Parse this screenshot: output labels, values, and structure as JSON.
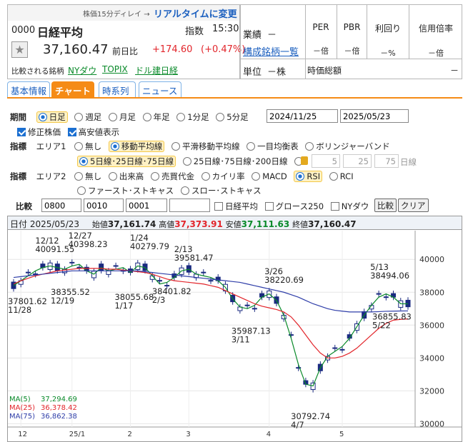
{
  "header": {
    "delay_text": "株価15分ディレイ →",
    "realtime_link": "リアルタイムに変更",
    "code": "0000",
    "name": "日経平均",
    "index_label": "指数",
    "time": "15:30",
    "price": "37,160.47",
    "prev_label": "前日比",
    "change": "+174.60",
    "change_pct": "(+0.47%)",
    "compare_label": "比較される銘柄",
    "compare_links": [
      "NYダウ",
      "TOPIX",
      "ドル建日経"
    ],
    "business_label": "業績",
    "business_value": "－",
    "constituents_link": "構成銘柄一覧",
    "unit_label": "単位",
    "unit_value": "－株",
    "market_cap_label": "時価総額",
    "market_cap_value": "－",
    "metrics": [
      {
        "label": "PER",
        "value": "－倍"
      },
      {
        "label": "PBR",
        "value": "－倍"
      },
      {
        "label": "利回り",
        "value": "－%"
      },
      {
        "label": "信用倍率",
        "value": "－倍"
      }
    ]
  },
  "tabs": [
    "基本情報",
    "チャート",
    "時系列",
    "ニュース"
  ],
  "controls": {
    "period_label": "期間",
    "periods": [
      "日足",
      "週足",
      "月足",
      "年足",
      "1分足",
      "5分足"
    ],
    "date_from": "2024/11/25",
    "date_to": "2025/05/23",
    "opt_adjusted": "修正株価",
    "opt_highlow": "高安値表示",
    "indicator_label": "指標",
    "area1_label": "エリア1",
    "area1_options": [
      "無し",
      "移動平均線",
      "平滑移動平均線",
      "一目均衡表",
      "ボリンジャーバンド"
    ],
    "ma_options": [
      "5日線･25日線･75日線",
      "25日線･75日線･200日線"
    ],
    "ma_inputs": [
      "5",
      "25",
      "75"
    ],
    "ma_unit": "日線",
    "area2_label": "エリア2",
    "area2_options": [
      "無し",
      "出来高",
      "売買代金",
      "カイリ率",
      "MACD",
      "RSI",
      "RCI"
    ],
    "area2_options_row2": [
      "ファースト･ストキャス",
      "スロー･ストキャス"
    ],
    "compare_label": "比較",
    "compare_inputs": [
      "0800",
      "0010",
      "0001",
      ""
    ],
    "compare_checks": [
      "日経平均",
      "グロース250",
      "NYダウ"
    ],
    "compare_button": "比較",
    "clear_button": "クリア"
  },
  "chart_info": {
    "date_label": "日付",
    "date": "2025/05/23",
    "open_label": "始値",
    "open": "37,161.74",
    "high_label": "高値",
    "high": "37,373.91",
    "low_label": "安値",
    "low": "37,111.63",
    "close_label": "終値",
    "close": "37,160.47"
  },
  "chart_data": {
    "type": "candlestick",
    "y_ticks": [
      "40000",
      "38000",
      "36000",
      "34000",
      "32000",
      "30000"
    ],
    "ylim": [
      29800,
      41400
    ],
    "x_ticks": [
      "12",
      "25/1",
      "2",
      "3",
      "4",
      "5"
    ],
    "annotations": [
      {
        "text": "12/12\n40091.55",
        "x": "2024-12-12",
        "y": 40091.55,
        "pos": "above"
      },
      {
        "text": "12/27\n40398.23",
        "x": "2024-12-27",
        "y": 40398.23,
        "pos": "above"
      },
      {
        "text": "1/24\n40279.79",
        "x": "2025-01-24",
        "y": 40279.79,
        "pos": "above"
      },
      {
        "text": "2/13\n39581.47",
        "x": "2025-02-13",
        "y": 39581.47,
        "pos": "above"
      },
      {
        "text": "3/26\n38220.69",
        "x": "2025-03-26",
        "y": 38220.69,
        "pos": "above"
      },
      {
        "text": "5/13\n38494.06",
        "x": "2025-05-13",
        "y": 38494.06,
        "pos": "above"
      },
      {
        "text": "37801.62\n11/28",
        "x": "2024-11-28",
        "y": 37801.62,
        "pos": "below"
      },
      {
        "text": "38355.52\n12/19",
        "x": "2024-12-19",
        "y": 38355.52,
        "pos": "below"
      },
      {
        "text": "38055.68\n1/17",
        "x": "2025-01-17",
        "y": 38055.68,
        "pos": "below"
      },
      {
        "text": "38401.82\n2/3",
        "x": "2025-02-03",
        "y": 38401.82,
        "pos": "below"
      },
      {
        "text": "35987.13\n3/11",
        "x": "2025-03-11",
        "y": 35987.13,
        "pos": "below"
      },
      {
        "text": "30792.74\n4/7",
        "x": "2025-04-07",
        "y": 30792.74,
        "pos": "below"
      },
      {
        "text": "36855.83\n5/22",
        "x": "2025-05-22",
        "y": 36855.83,
        "pos": "below"
      }
    ],
    "series": [
      {
        "name": "MA(5)",
        "value": "37,294.69",
        "color": "#0a8a2a",
        "values": [
          38400,
          38700,
          39000,
          39300,
          39500,
          39600,
          39500,
          39400,
          39600,
          39700,
          39300,
          39100,
          39500,
          39300,
          39400,
          39500,
          39200,
          39600,
          39500,
          39000,
          38500,
          38600,
          38900,
          39300,
          39400,
          39100,
          39000,
          38900,
          38700,
          38300,
          37600,
          37100,
          37000,
          37200,
          37700,
          37900,
          37500,
          36600,
          35200,
          33600,
          32400,
          32300,
          33400,
          34100,
          34400,
          34700,
          35200,
          35900,
          36600,
          37200,
          37700,
          37900,
          37700,
          37300,
          37294
        ]
      },
      {
        "name": "MA(25)",
        "value": "36,378.42",
        "color": "#e2252b",
        "values": [
          38500,
          38700,
          38850,
          39000,
          39100,
          39200,
          39300,
          39350,
          39400,
          39450,
          39450,
          39450,
          39450,
          39400,
          39400,
          39350,
          39300,
          39250,
          39200,
          39100,
          38950,
          38800,
          38700,
          38650,
          38600,
          38550,
          38500,
          38400,
          38300,
          38100,
          37900,
          37700,
          37500,
          37300,
          37150,
          37050,
          36950,
          36800,
          36500,
          36000,
          35400,
          34800,
          34300,
          34000,
          34000,
          34100,
          34300,
          34600,
          35000,
          35400,
          35800,
          36100,
          36300,
          36350,
          36378
        ]
      },
      {
        "name": "MA(75)",
        "value": "36,862.38",
        "color": "#2e3da8",
        "values": [
          38900,
          38950,
          39000,
          39050,
          39100,
          39150,
          39200,
          39250,
          39300,
          39300,
          39300,
          39300,
          39300,
          39300,
          39300,
          39300,
          39300,
          39300,
          39250,
          39200,
          39150,
          39100,
          39050,
          39000,
          38950,
          38900,
          38850,
          38800,
          38750,
          38700,
          38650,
          38600,
          38500,
          38400,
          38300,
          38200,
          38100,
          38000,
          37850,
          37700,
          37500,
          37300,
          37150,
          37000,
          36900,
          36850,
          36800,
          36800,
          36800,
          36800,
          36820,
          36840,
          36850,
          36860,
          36862
        ]
      }
    ]
  }
}
